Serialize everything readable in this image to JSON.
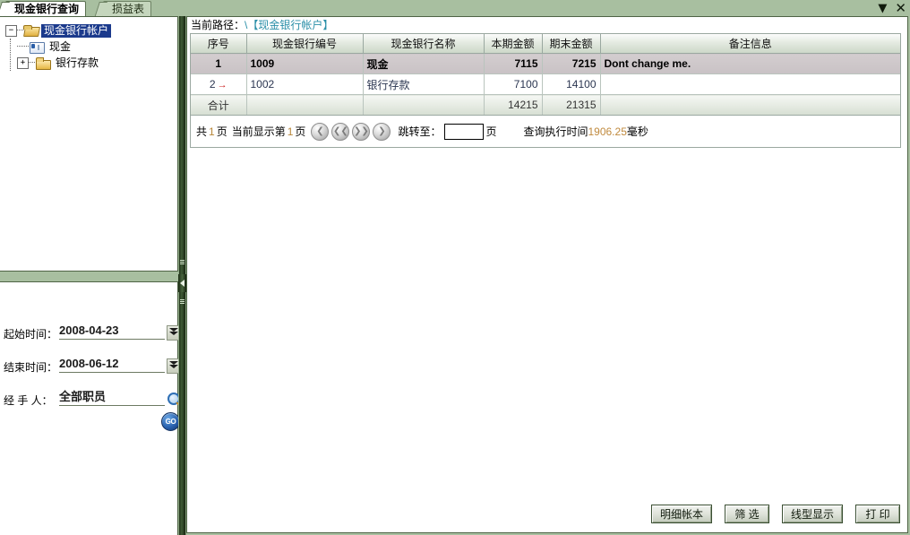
{
  "window": {
    "minimize_icon": "chevron-down-icon",
    "close_icon": "close-icon",
    "minimize_glyph": "▼",
    "close_glyph": "✕"
  },
  "tabs": [
    {
      "label": "现金银行查询",
      "active": true
    },
    {
      "label": "损益表",
      "active": false
    }
  ],
  "tree": {
    "root": {
      "label": "现金银行帐户",
      "toggle": "−",
      "icon": "folder-open-icon",
      "selected": true
    },
    "children": [
      {
        "label": "现金",
        "toggle": "",
        "icon": "card-icon"
      },
      {
        "label": "银行存款",
        "toggle": "+",
        "icon": "folder-icon"
      }
    ]
  },
  "form": {
    "fields": [
      {
        "label": "起始时间：",
        "value": "2008-04-23",
        "control": "date-spinner"
      },
      {
        "label": "结束时间：",
        "value": "2008-06-12",
        "control": "date-spinner"
      },
      {
        "label": "经 手 人：",
        "value": "全部职员",
        "control": "lookup"
      }
    ],
    "go_label": "GO"
  },
  "breadcrumb": {
    "label": "当前路径：",
    "path": "\\【现金银行帐户】"
  },
  "grid": {
    "columns": [
      "序号",
      "现金银行编号",
      "现金银行名称",
      "本期金额",
      "期末金额",
      "备注信息"
    ],
    "rows": [
      {
        "seq": "1",
        "code": "1009",
        "name": "现金",
        "current": "7115",
        "ending": "7215",
        "remark": "Dont change me.",
        "selected": true,
        "marker": ""
      },
      {
        "seq": "2",
        "code": "1002",
        "name": "银行存款",
        "current": "7100",
        "ending": "14100",
        "remark": "",
        "selected": false,
        "marker": "→"
      }
    ],
    "total_row": {
      "seq": "合计",
      "code": "",
      "name": "",
      "current": "14215",
      "ending": "21315",
      "remark": ""
    }
  },
  "pager": {
    "prefix": "共",
    "total_pages": "1",
    "pages_unit": "页",
    "current_label": "当前显示第",
    "current_page": "1",
    "current_unit": "页",
    "nav": [
      {
        "name": "prev-page-button",
        "glyph": "❮"
      },
      {
        "name": "first-page-button",
        "glyph": "❮❮"
      },
      {
        "name": "last-page-button",
        "glyph": "❯❯"
      },
      {
        "name": "next-page-button",
        "glyph": "❯"
      }
    ],
    "jump_label": "跳转至：",
    "jump_value": "",
    "jump_unit": "页",
    "query_time_label": "查询执行时间",
    "query_time_value": "1906.25",
    "query_time_unit": "毫秒"
  },
  "actions": [
    {
      "label": "明细帐本"
    },
    {
      "label": "筛 选"
    },
    {
      "label": "线型显示"
    },
    {
      "label": "打 印"
    }
  ],
  "colors": {
    "app_background": "#a8bfa0",
    "panel_border": "#4e6345",
    "tab_active_bg": "#ffffff",
    "tab_inactive_bg": "#c5d6bd",
    "tree_selection": "#1b3a8c",
    "breadcrumb_path": "#2b8fa8",
    "pager_number": "#b8873a",
    "row_selected_bg": "#cdc6c9",
    "splitter": "#203318"
  }
}
